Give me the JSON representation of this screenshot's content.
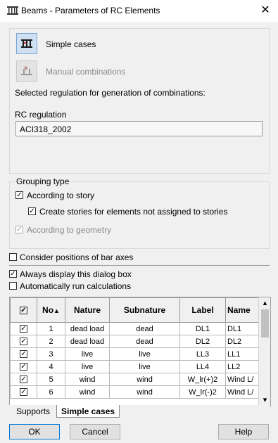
{
  "window": {
    "title": "Beams - Parameters of RC Elements"
  },
  "calc_options": {
    "simple_cases_label": "Simple cases",
    "manual_combinations_label": "Manual combinations",
    "selected_regulation_text": "Selected regulation for generation of combinations:",
    "rc_regulation_label": "RC regulation",
    "rc_regulation_value": "ACI318_2002"
  },
  "grouping": {
    "title": "Grouping type",
    "according_to_story": "According to story",
    "create_stories": "Create stories for elements not assigned to stories",
    "according_to_geometry": "According to geometry"
  },
  "options": {
    "consider_positions": "Consider positions of bar axes",
    "always_display": "Always display this dialog box",
    "auto_run": "Automatically run calculations"
  },
  "table": {
    "headers": [
      "No",
      "Nature",
      "Subnature",
      "Label",
      "Name"
    ],
    "rows": [
      {
        "no": "1",
        "nature": "dead load",
        "subnature": "dead",
        "label": "DL1",
        "name": "DL1"
      },
      {
        "no": "2",
        "nature": "dead load",
        "subnature": "dead",
        "label": "DL2",
        "name": "DL2"
      },
      {
        "no": "3",
        "nature": "live",
        "subnature": "live",
        "label": "LL3",
        "name": "LL1"
      },
      {
        "no": "4",
        "nature": "live",
        "subnature": "live",
        "label": "LL4",
        "name": "LL2"
      },
      {
        "no": "5",
        "nature": "wind",
        "subnature": "wind",
        "label": "W_lr(+)2",
        "name": "Wind L/"
      },
      {
        "no": "6",
        "nature": "wind",
        "subnature": "wind",
        "label": "W_lr(-)2",
        "name": "Wind L/"
      }
    ]
  },
  "tabs": [
    "Supports",
    "Simple cases"
  ],
  "buttons": {
    "ok": "OK",
    "cancel": "Cancel",
    "help": "Help"
  },
  "icons": {
    "check": "✓",
    "sort_up": "▲",
    "scroll_up": "▴",
    "scroll_down": "▾",
    "close": "✕"
  }
}
